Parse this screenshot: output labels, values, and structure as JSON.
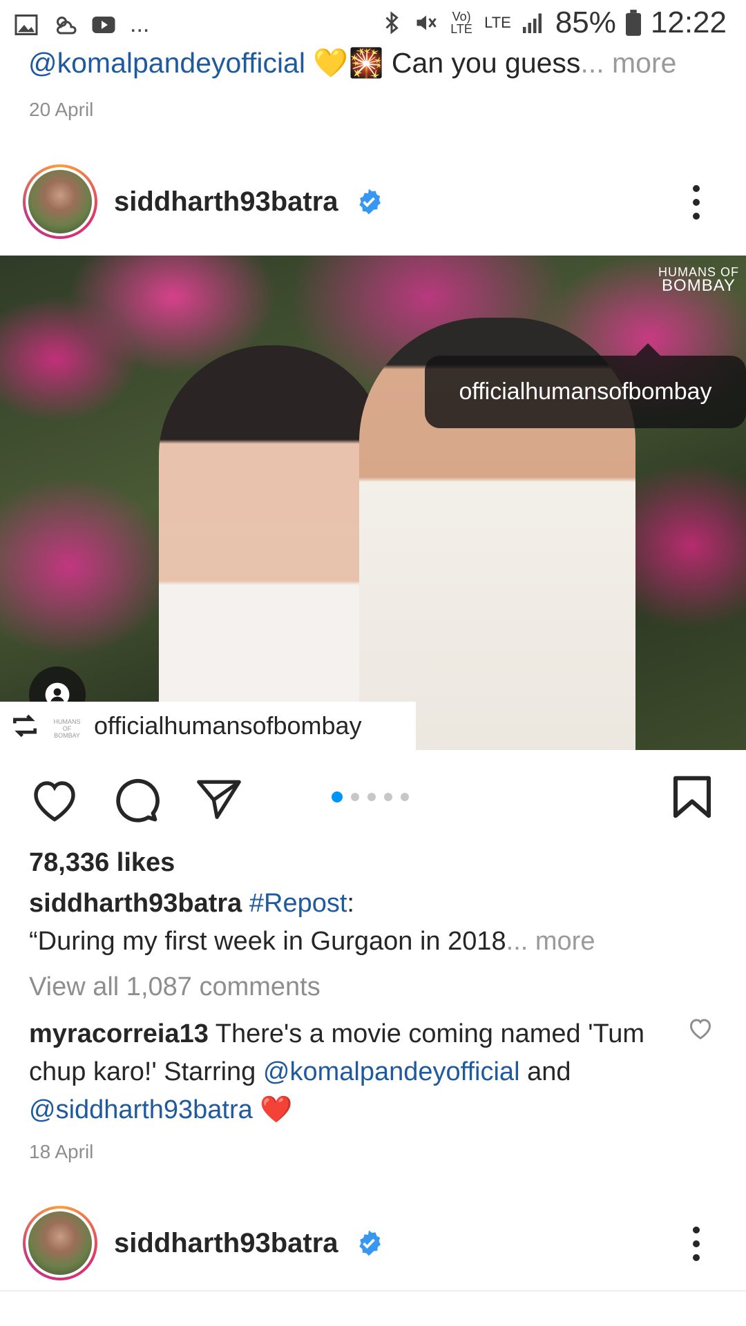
{
  "status_bar": {
    "battery": "85%",
    "time": "12:22",
    "volte": "Vo) LTE",
    "lte": "LTE",
    "ellipsis": "..."
  },
  "prev_post": {
    "caption_mention": "@komalpandeyofficial",
    "caption_text": "Can you guess",
    "more": "... more",
    "date": "20 April"
  },
  "post": {
    "username": "siddharth93batra",
    "image_watermark": [
      "HUMANS OF",
      "BOMBAY"
    ],
    "tagged_user": "officialhumansofbombay",
    "repost_source": "officialhumansofbombay",
    "repost_logo_text": [
      "HUMANS OF",
      "BOMBAY"
    ],
    "carousel_count": 5,
    "carousel_index": 1,
    "likes": "78,336 likes",
    "caption_user": "siddharth93batra",
    "caption_tag": "#Repost",
    "caption_colon": ":",
    "caption_text": "“During my first week in Gurgaon in 2018",
    "caption_more": "... more",
    "view_comments": "View all 1,087 comments",
    "comment": {
      "user": "myracorreia13",
      "text1": "There's a movie coming named 'Tum chup karo!' Starring",
      "mention1": "@komalpandeyofficial",
      "text2": "and",
      "mention2": "@siddharth93batra",
      "emoji": "❤️"
    },
    "date": "18 April"
  },
  "next_post": {
    "username": "siddharth93batra"
  },
  "colors": {
    "link": "#1f5a9e",
    "verified": "#3897f0",
    "dot_active": "#0095f6"
  }
}
